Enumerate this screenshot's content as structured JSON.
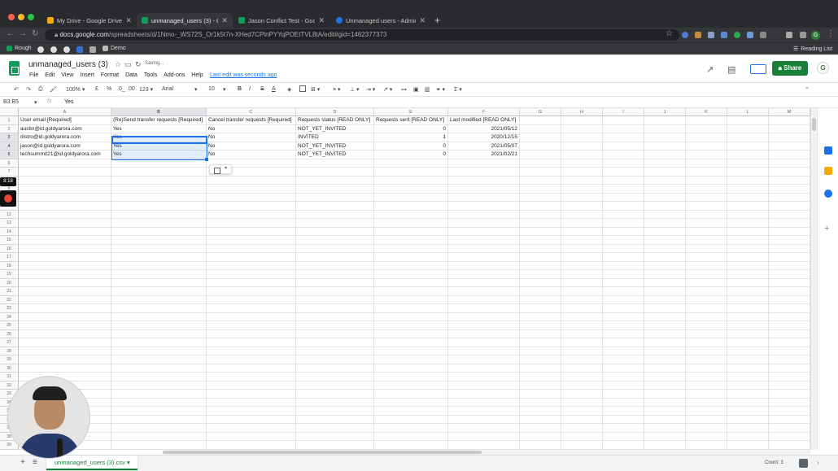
{
  "browser": {
    "tabs": [
      {
        "label": "My Drive - Google Drive",
        "color": "#f9ab00"
      },
      {
        "label": "unmanaged_users (3) - Google",
        "color": "#0f9d58"
      },
      {
        "label": "Jason Conflict Test - Google S",
        "color": "#0f9d58"
      },
      {
        "label": "Unmanaged users - Admin Co",
        "color": "#1a73e8"
      }
    ],
    "new_tab": "+",
    "url_host": "docs.google.com",
    "url_path": "/spreadsheets/d/1Nmo-_WS72S_Or1k5t7n-XHed7CPlnPYYqPOEITVL8tA/edit#gid=1462377373",
    "bookmarks": [
      "Rough",
      "Demo"
    ],
    "reading_list": "Reading List",
    "profile_initial": "G"
  },
  "app": {
    "doc_title": "unmanaged_users (3)",
    "saving": "Saving...",
    "menu": [
      "File",
      "Edit",
      "View",
      "Insert",
      "Format",
      "Data",
      "Tools",
      "Add-ons",
      "Help"
    ],
    "last_edit": "Last edit was seconds ago",
    "share": "Share",
    "account_initial": "G"
  },
  "toolbar": {
    "zoom": "100%",
    "currency": "£",
    "percent": "%",
    "dec_less": ".0_",
    "dec_more": ".00",
    "number_format": "123",
    "font": "Arial",
    "size": "10",
    "bold": "B",
    "italic": "I",
    "strike": "S",
    "text_color": "A",
    "functions": "Σ"
  },
  "formula": {
    "namebox": "B3:B5",
    "fx": "fx",
    "value": "Yes"
  },
  "grid": {
    "columns": [
      "A",
      "B",
      "C",
      "D",
      "E",
      "F",
      "G",
      "H",
      "I",
      "J",
      "K",
      "L",
      "M"
    ],
    "rows": [
      [
        "User email [Required]",
        "(Re)Send transfer requests [Required]",
        "Cancel transfer requests [Required]",
        "Requests status [READ ONLY]",
        "Requests sent [READ ONLY]",
        "Last modified [READ ONLY]"
      ],
      [
        "austin@id.goldyarora.com",
        "Yes",
        "No",
        "NOT_YET_INVITED",
        "0",
        "2021/05/12"
      ],
      [
        "distro@id.goldyarora.com",
        "Yes",
        "No",
        "INVITED",
        "1",
        "2020/12/15"
      ],
      [
        "jason@id.goldyarora.com",
        "Yes",
        "No",
        "NOT_YET_INVITED",
        "0",
        "2021/05/07"
      ],
      [
        "techsummit21@id.goldyarora.com",
        "Yes",
        "No",
        "NOT_YET_INVITED",
        "0",
        "2021/02/21"
      ]
    ],
    "row_count": 39
  },
  "sheets": {
    "add": "+",
    "list": "≡",
    "active_tab": "unmanaged_users (3).csv",
    "count": "Count: 3"
  },
  "overlay": {
    "timer": "8:18"
  }
}
